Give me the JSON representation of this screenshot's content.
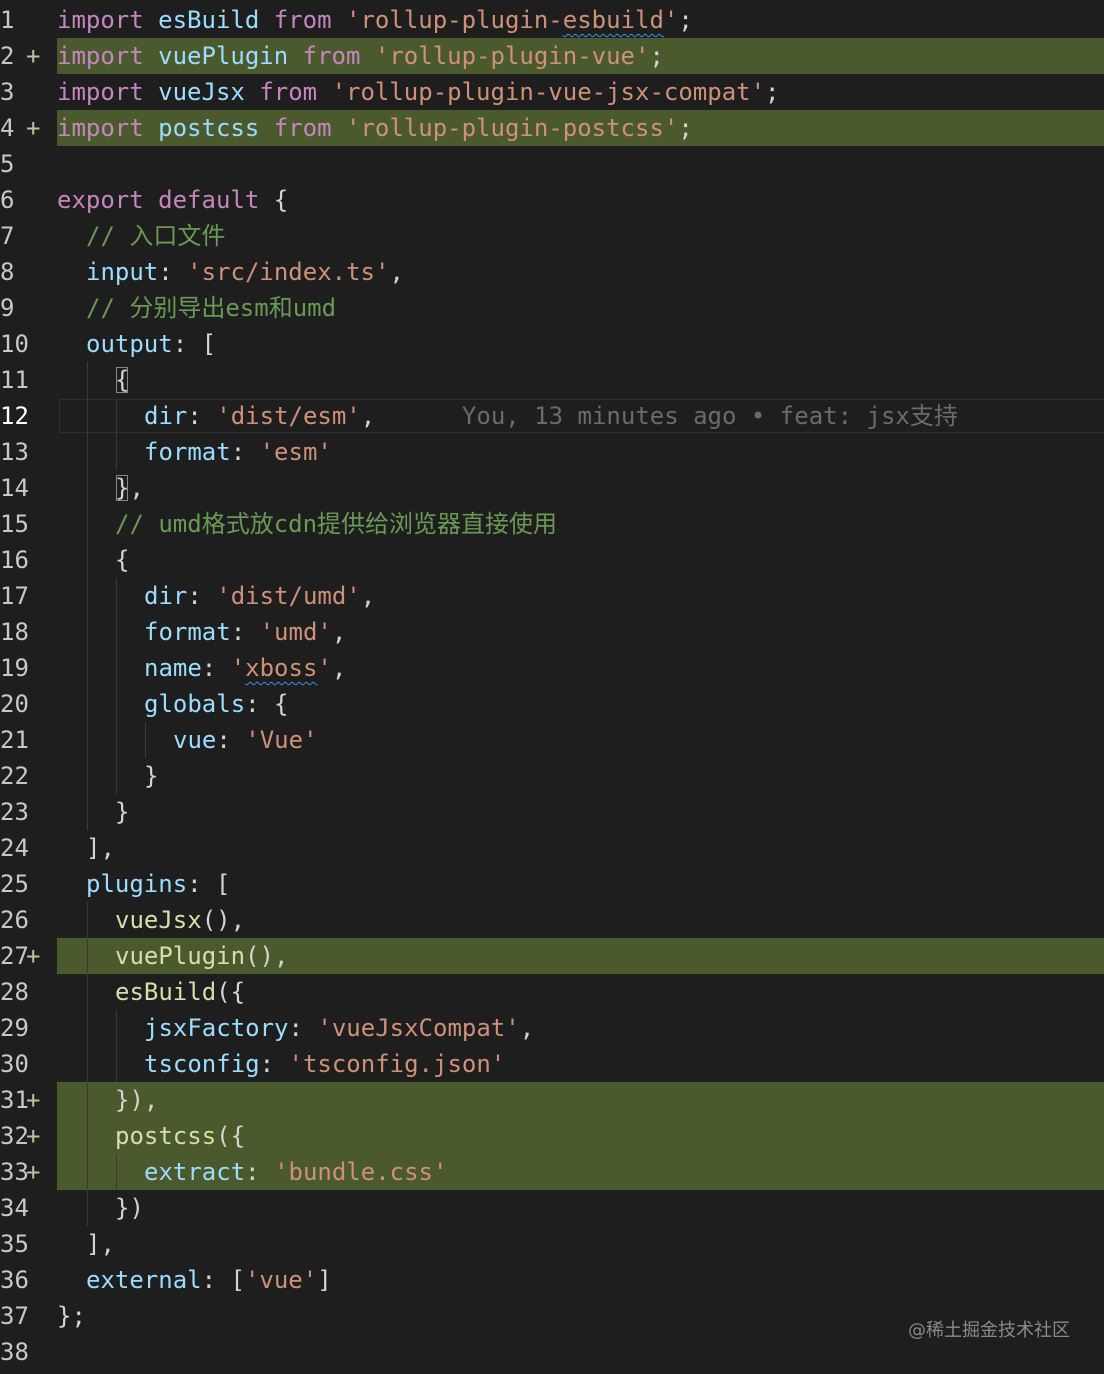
{
  "editor": {
    "lines": [
      {
        "n": "1",
        "marker": "",
        "added": false,
        "indent": 0,
        "tokens": [
          {
            "t": "import",
            "c": "kw"
          },
          {
            "t": " "
          },
          {
            "t": "esBuild",
            "c": "var"
          },
          {
            "t": " "
          },
          {
            "t": "from",
            "c": "kw"
          },
          {
            "t": " "
          },
          {
            "t": "'rollup-plugin-",
            "c": "str"
          },
          {
            "t": "esbuild",
            "c": "str",
            "squiggle": true
          },
          {
            "t": "'",
            "c": "str"
          },
          {
            "t": ";"
          }
        ]
      },
      {
        "n": "2",
        "marker": "+",
        "added": true,
        "indent": 0,
        "tokens": [
          {
            "t": "import",
            "c": "kw"
          },
          {
            "t": " "
          },
          {
            "t": "vuePlugin",
            "c": "var"
          },
          {
            "t": " "
          },
          {
            "t": "from",
            "c": "kw"
          },
          {
            "t": " "
          },
          {
            "t": "'rollup-plugin-vue'",
            "c": "str"
          },
          {
            "t": ";"
          }
        ]
      },
      {
        "n": "3",
        "marker": "",
        "added": false,
        "indent": 0,
        "tokens": [
          {
            "t": "import",
            "c": "kw"
          },
          {
            "t": " "
          },
          {
            "t": "vueJsx",
            "c": "var"
          },
          {
            "t": " "
          },
          {
            "t": "from",
            "c": "kw"
          },
          {
            "t": " "
          },
          {
            "t": "'rollup-plugin-vue-jsx-compat'",
            "c": "str"
          },
          {
            "t": ";"
          }
        ]
      },
      {
        "n": "4",
        "marker": "+",
        "added": true,
        "indent": 0,
        "tokens": [
          {
            "t": "import",
            "c": "kw"
          },
          {
            "t": " "
          },
          {
            "t": "postcss",
            "c": "var"
          },
          {
            "t": " "
          },
          {
            "t": "from",
            "c": "kw"
          },
          {
            "t": " "
          },
          {
            "t": "'rollup-plugin-postcss'",
            "c": "str"
          },
          {
            "t": ";"
          }
        ]
      },
      {
        "n": "5",
        "marker": "",
        "added": false,
        "indent": 0,
        "tokens": []
      },
      {
        "n": "6",
        "marker": "",
        "added": false,
        "indent": 0,
        "tokens": [
          {
            "t": "export",
            "c": "kw"
          },
          {
            "t": " "
          },
          {
            "t": "default",
            "c": "kw"
          },
          {
            "t": " {"
          }
        ]
      },
      {
        "n": "7",
        "marker": "",
        "added": false,
        "indent": 1,
        "tokens": [
          {
            "t": "// 入口文件",
            "c": "cm"
          }
        ]
      },
      {
        "n": "8",
        "marker": "",
        "added": false,
        "indent": 1,
        "tokens": [
          {
            "t": "input",
            "c": "var"
          },
          {
            "t": ": "
          },
          {
            "t": "'src/index.ts'",
            "c": "str"
          },
          {
            "t": ","
          }
        ]
      },
      {
        "n": "9",
        "marker": "",
        "added": false,
        "indent": 1,
        "tokens": [
          {
            "t": "// 分别导出esm和umd",
            "c": "cm"
          }
        ]
      },
      {
        "n": "10",
        "marker": "",
        "added": false,
        "indent": 1,
        "tokens": [
          {
            "t": "output",
            "c": "var"
          },
          {
            "t": ": ["
          }
        ]
      },
      {
        "n": "11",
        "marker": "",
        "added": false,
        "indent": 2,
        "tokens": [
          {
            "t": "{",
            "bracket": true
          }
        ]
      },
      {
        "n": "12",
        "marker": "",
        "added": false,
        "indent": 3,
        "current": true,
        "tokens": [
          {
            "t": "dir",
            "c": "var"
          },
          {
            "t": ": "
          },
          {
            "t": "'dist/esm'",
            "c": "str"
          },
          {
            "t": ","
          }
        ],
        "blame": "You, 13 minutes ago • feat: jsx支持"
      },
      {
        "n": "13",
        "marker": "",
        "added": false,
        "indent": 3,
        "tokens": [
          {
            "t": "format",
            "c": "var"
          },
          {
            "t": ": "
          },
          {
            "t": "'esm'",
            "c": "str"
          }
        ]
      },
      {
        "n": "14",
        "marker": "",
        "added": false,
        "indent": 2,
        "tokens": [
          {
            "t": "}",
            "bracket": true
          },
          {
            "t": ","
          }
        ]
      },
      {
        "n": "15",
        "marker": "",
        "added": false,
        "indent": 2,
        "tokens": [
          {
            "t": "// umd格式放cdn提供给浏览器直接使用",
            "c": "cm"
          }
        ]
      },
      {
        "n": "16",
        "marker": "",
        "added": false,
        "indent": 2,
        "tokens": [
          {
            "t": "{"
          }
        ]
      },
      {
        "n": "17",
        "marker": "",
        "added": false,
        "indent": 3,
        "tokens": [
          {
            "t": "dir",
            "c": "var"
          },
          {
            "t": ": "
          },
          {
            "t": "'dist/umd'",
            "c": "str"
          },
          {
            "t": ","
          }
        ]
      },
      {
        "n": "18",
        "marker": "",
        "added": false,
        "indent": 3,
        "tokens": [
          {
            "t": "format",
            "c": "var"
          },
          {
            "t": ": "
          },
          {
            "t": "'umd'",
            "c": "str"
          },
          {
            "t": ","
          }
        ]
      },
      {
        "n": "19",
        "marker": "",
        "added": false,
        "indent": 3,
        "tokens": [
          {
            "t": "name",
            "c": "var"
          },
          {
            "t": ": "
          },
          {
            "t": "'",
            "c": "str"
          },
          {
            "t": "xboss",
            "c": "str",
            "squiggle": true
          },
          {
            "t": "'",
            "c": "str"
          },
          {
            "t": ","
          }
        ]
      },
      {
        "n": "20",
        "marker": "",
        "added": false,
        "indent": 3,
        "tokens": [
          {
            "t": "globals",
            "c": "var"
          },
          {
            "t": ": {"
          }
        ]
      },
      {
        "n": "21",
        "marker": "",
        "added": false,
        "indent": 4,
        "tokens": [
          {
            "t": "vue",
            "c": "var"
          },
          {
            "t": ": "
          },
          {
            "t": "'Vue'",
            "c": "str"
          }
        ]
      },
      {
        "n": "22",
        "marker": "",
        "added": false,
        "indent": 3,
        "tokens": [
          {
            "t": "}"
          }
        ]
      },
      {
        "n": "23",
        "marker": "",
        "added": false,
        "indent": 2,
        "tokens": [
          {
            "t": "}"
          }
        ]
      },
      {
        "n": "24",
        "marker": "",
        "added": false,
        "indent": 1,
        "tokens": [
          {
            "t": "],"
          }
        ]
      },
      {
        "n": "25",
        "marker": "",
        "added": false,
        "indent": 1,
        "tokens": [
          {
            "t": "plugins",
            "c": "var"
          },
          {
            "t": ": ["
          }
        ]
      },
      {
        "n": "26",
        "marker": "",
        "added": false,
        "indent": 2,
        "tokens": [
          {
            "t": "vueJsx",
            "c": "fn"
          },
          {
            "t": "(),"
          }
        ]
      },
      {
        "n": "27",
        "marker": "+",
        "added": true,
        "indent": 2,
        "tokens": [
          {
            "t": "vuePlugin",
            "c": "fn"
          },
          {
            "t": "(),"
          }
        ]
      },
      {
        "n": "28",
        "marker": "",
        "added": false,
        "indent": 2,
        "tokens": [
          {
            "t": "esBuild",
            "c": "fn"
          },
          {
            "t": "({"
          }
        ]
      },
      {
        "n": "29",
        "marker": "",
        "added": false,
        "indent": 3,
        "tokens": [
          {
            "t": "jsxFactory",
            "c": "var"
          },
          {
            "t": ": "
          },
          {
            "t": "'vueJsxCompat'",
            "c": "str"
          },
          {
            "t": ","
          }
        ]
      },
      {
        "n": "30",
        "marker": "",
        "added": false,
        "indent": 3,
        "tokens": [
          {
            "t": "tsconfig",
            "c": "var"
          },
          {
            "t": ": "
          },
          {
            "t": "'tsconfig.json'",
            "c": "str"
          }
        ]
      },
      {
        "n": "31",
        "marker": "+",
        "added": true,
        "indent": 2,
        "tokens": [
          {
            "t": "}),"
          }
        ]
      },
      {
        "n": "32",
        "marker": "+",
        "added": true,
        "indent": 2,
        "tokens": [
          {
            "t": "postcss",
            "c": "fn"
          },
          {
            "t": "({"
          }
        ]
      },
      {
        "n": "33",
        "marker": "+",
        "added": true,
        "indent": 3,
        "tokens": [
          {
            "t": "extract",
            "c": "var"
          },
          {
            "t": ": "
          },
          {
            "t": "'bundle.css'",
            "c": "str"
          }
        ]
      },
      {
        "n": "34",
        "marker": "",
        "added": false,
        "indent": 2,
        "tokens": [
          {
            "t": "})"
          }
        ]
      },
      {
        "n": "35",
        "marker": "",
        "added": false,
        "indent": 1,
        "tokens": [
          {
            "t": "],"
          }
        ]
      },
      {
        "n": "36",
        "marker": "",
        "added": false,
        "indent": 1,
        "tokens": [
          {
            "t": "external",
            "c": "var"
          },
          {
            "t": ": ["
          },
          {
            "t": "'vue'",
            "c": "str"
          },
          {
            "t": "]"
          }
        ]
      },
      {
        "n": "37",
        "marker": "",
        "added": false,
        "indent": 0,
        "tokens": [
          {
            "t": "};"
          }
        ]
      },
      {
        "n": "38",
        "marker": "",
        "added": false,
        "indent": 0,
        "tokens": []
      }
    ]
  },
  "watermark": "@稀土掘金技术社区"
}
